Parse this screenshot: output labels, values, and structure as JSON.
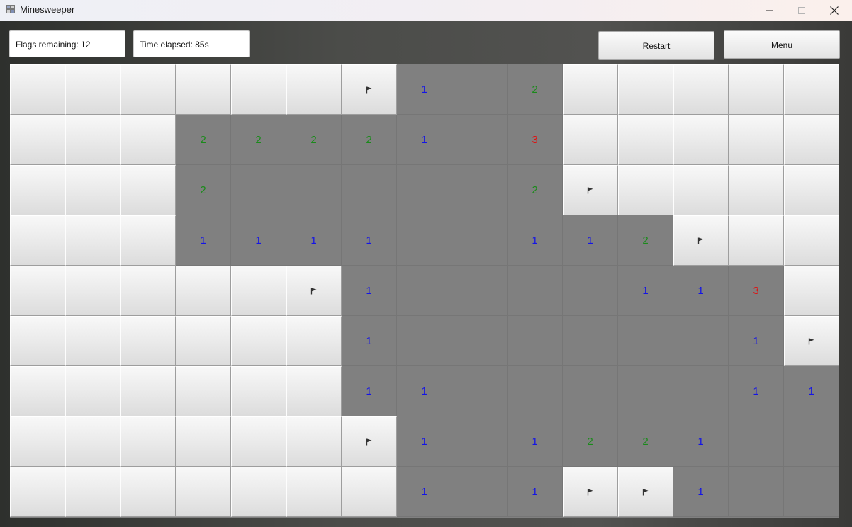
{
  "window": {
    "title": "Minesweeper",
    "icon": "minesweeper-app-icon",
    "controls": [
      "minimize-icon",
      "maximize-icon",
      "close-icon"
    ]
  },
  "status": {
    "flags_remaining": "Flags remaining: 12",
    "time_elapsed": "Time elapsed: 85s"
  },
  "buttons": {
    "restart": "Restart",
    "menu": "Menu"
  },
  "colors": {
    "number_1": "#1414e6",
    "number_2": "#1a8a1a",
    "number_3": "#e01010",
    "revealed": "#808080",
    "flag": "#333333"
  },
  "board": {
    "columns": 15,
    "rows": [
      [
        "H",
        "H",
        "H",
        "H",
        "H",
        "H",
        "F",
        "1",
        "",
        "2",
        "H",
        "H",
        "H",
        "H",
        "H"
      ],
      [
        "H",
        "H",
        "H",
        "2",
        "2",
        "2",
        "2",
        "1",
        "",
        "3",
        "H",
        "H",
        "H",
        "H",
        "H"
      ],
      [
        "H",
        "H",
        "H",
        "2",
        "",
        "",
        "",
        "",
        "",
        "2",
        "F",
        "H",
        "H",
        "H",
        "H"
      ],
      [
        "H",
        "H",
        "H",
        "1",
        "1",
        "1",
        "1",
        "",
        "",
        "1",
        "1",
        "2",
        "F",
        "H",
        "H"
      ],
      [
        "H",
        "H",
        "H",
        "H",
        "H",
        "F",
        "1",
        "",
        "",
        "",
        "",
        "1",
        "1",
        "3",
        "H"
      ],
      [
        "H",
        "H",
        "H",
        "H",
        "H",
        "H",
        "1",
        "",
        "",
        "",
        "",
        "",
        "",
        "1",
        "F"
      ],
      [
        "H",
        "H",
        "H",
        "H",
        "H",
        "H",
        "1",
        "1",
        "",
        "",
        "",
        "",
        "",
        "1",
        "1"
      ],
      [
        "H",
        "H",
        "H",
        "H",
        "H",
        "H",
        "F",
        "1",
        "",
        "1",
        "2",
        "2",
        "1",
        "",
        ""
      ],
      [
        "H",
        "H",
        "H",
        "H",
        "H",
        "H",
        "H",
        "1",
        "",
        "1",
        "F",
        "F",
        "1",
        "",
        ""
      ]
    ]
  }
}
